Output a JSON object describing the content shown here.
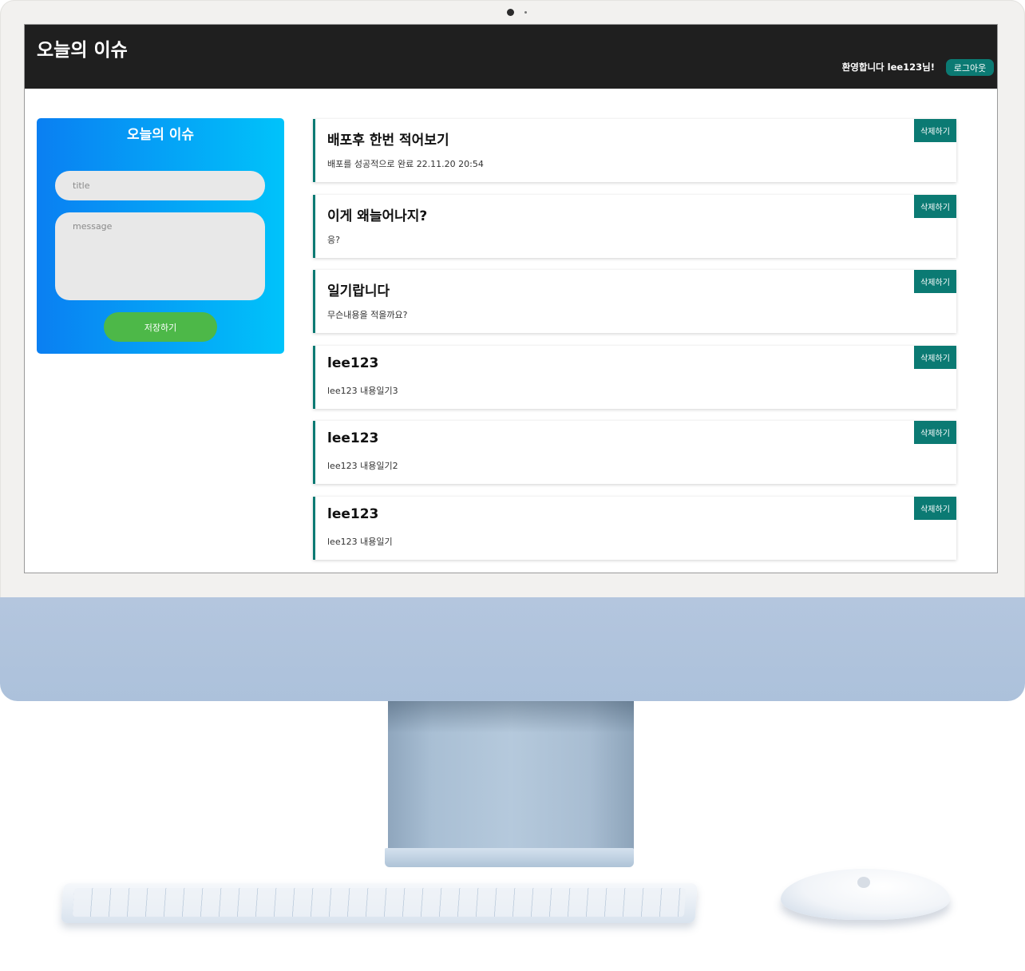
{
  "header": {
    "title": "오늘의 이슈",
    "welcome": "환영합니다 lee123님!",
    "logout_label": "로그아웃"
  },
  "form": {
    "title": "오늘의 이슈",
    "title_placeholder": "title",
    "message_placeholder": "message",
    "save_label": "저장하기"
  },
  "posts": [
    {
      "title": "배포후 한번 적어보기",
      "body": "배포를 성공적으로 완료 22.11.20 20:54",
      "delete_label": "삭제하기"
    },
    {
      "title": "이게 왜늘어나지?",
      "body": "응?",
      "delete_label": "삭제하기"
    },
    {
      "title": "일기랍니다",
      "body": "무슨내용을 적을까요?",
      "delete_label": "삭제하기"
    },
    {
      "title": "lee123",
      "body": "lee123 내용일기3",
      "delete_label": "삭제하기"
    },
    {
      "title": "lee123",
      "body": "lee123 내용일기2",
      "delete_label": "삭제하기"
    },
    {
      "title": "lee123",
      "body": "lee123 내용일기",
      "delete_label": "삭제하기"
    }
  ],
  "colors": {
    "header_bg": "#1f1f1f",
    "accent_teal": "#0b7a73",
    "save_green": "#4db848",
    "card_gradient_start": "#0a7ff2",
    "card_gradient_end": "#00c3fa",
    "device_blue": "#acc1db"
  }
}
